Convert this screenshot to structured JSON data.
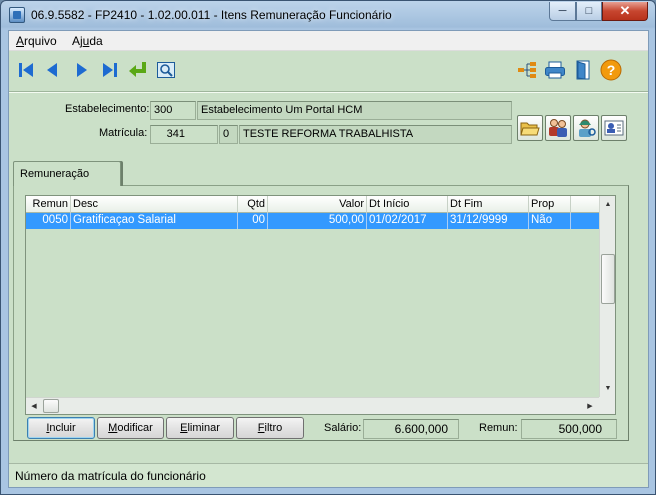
{
  "window": {
    "title": "06.9.5582 - FP2410 - 1.02.00.011 - Itens Remuneração Funcionário",
    "minimize": "─",
    "maximize": "□",
    "close": "✕"
  },
  "menu": {
    "arquivo": {
      "pre": "",
      "acc": "A",
      "post": "rquivo"
    },
    "ajuda": {
      "pre": "Aj",
      "acc": "u",
      "post": "da"
    }
  },
  "toolbar": {
    "icons": [
      "first-record-icon",
      "previous-record-icon",
      "next-record-icon",
      "last-record-icon",
      "return-icon",
      "zoom-icon",
      "tree-icon",
      "print-icon",
      "exit-door-icon",
      "help-icon"
    ],
    "help_glyph": "?"
  },
  "header": {
    "estabelecimento_label": "Estabelecimento:",
    "estabelecimento_code": "300",
    "estabelecimento_name": "Estabelecimento Um Portal HCM",
    "matricula_label": "Matrícula:",
    "matricula_number": "341",
    "matricula_digit": "0",
    "matricula_name": "TESTE REFORMA TRABALHISTA"
  },
  "tab": {
    "label": "Remuneração"
  },
  "grid": {
    "columns": [
      "Remun",
      "Desc",
      "Qtd",
      "Valor",
      "Dt Início",
      "Dt Fim",
      "Prop"
    ],
    "rows": [
      {
        "remun": "0050",
        "desc": "Gratificaçao Salarial",
        "qtd": "00",
        "valor": "500,00",
        "dt_inicio": "01/02/2017",
        "dt_fim": "31/12/9999",
        "prop": "Não"
      }
    ],
    "scroll_up": "▲",
    "scroll_down": "▼",
    "scroll_left": "◀",
    "scroll_right": "▶"
  },
  "buttons": {
    "incluir": {
      "pre": "",
      "acc": "I",
      "post": "ncluir"
    },
    "modificar": {
      "pre": "",
      "acc": "M",
      "post": "odificar"
    },
    "eliminar": {
      "pre": "",
      "acc": "E",
      "post": "liminar"
    },
    "filtro": {
      "pre": "",
      "acc": "F",
      "post": "iltro"
    }
  },
  "totals": {
    "salario_label": "Salário:",
    "salario_value": "6.600,000",
    "remun_label": "Remun:",
    "remun_value": "500,000"
  },
  "status": {
    "text": "Número da matrícula do funcionário"
  },
  "colors": {
    "selection": "#3399ff",
    "panel": "#cbe0c8",
    "nav_blue": "#1d6bd1",
    "help_orange": "#f29a0d"
  }
}
